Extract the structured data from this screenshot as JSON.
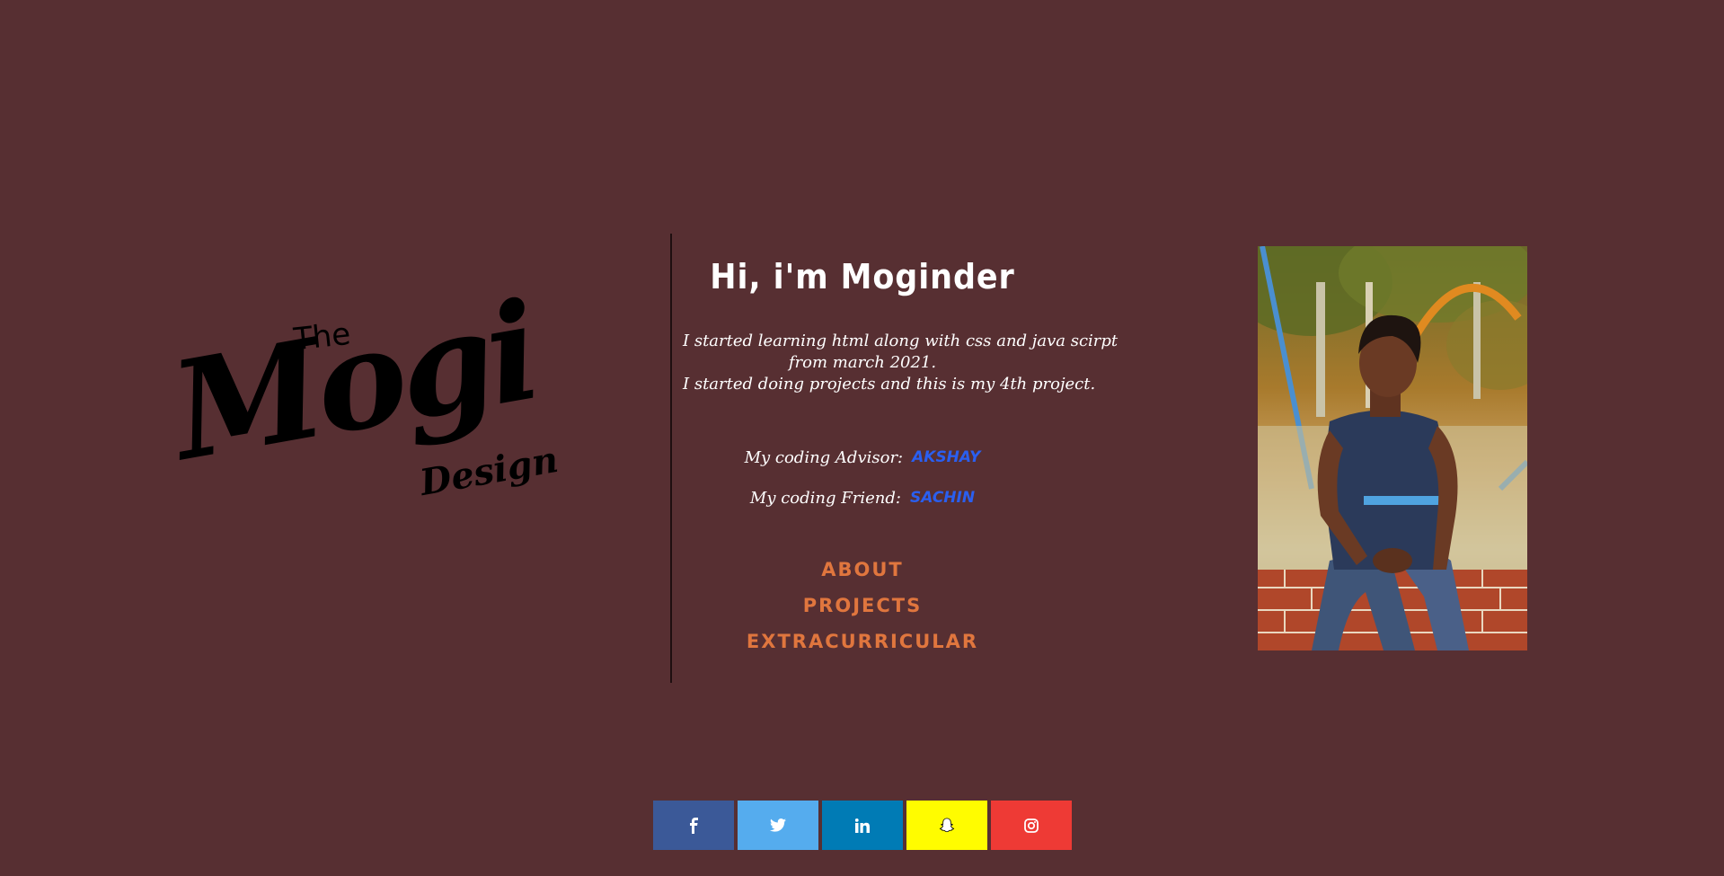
{
  "logo": {
    "the": "The",
    "mogi": "Mogi",
    "design": "Design"
  },
  "greeting": "Hi, i'm Moginder",
  "intro": {
    "line1": "I started learning html along with css and java scirpt",
    "line2": "from march 2021.",
    "line3": "I started doing projects and this is my 4th project."
  },
  "credits": {
    "advisor_label": "My coding Advisor:",
    "advisor_name": "AKSHAY",
    "friend_label": "My coding Friend:",
    "friend_name": "SACHIN"
  },
  "nav": {
    "about": "ABOUT",
    "projects": "PROJECTS",
    "extracurricular": "EXTRACURRICULAR"
  },
  "social": [
    {
      "name": "facebook",
      "icon": "facebook-icon",
      "color": "#3b5998"
    },
    {
      "name": "twitter",
      "icon": "twitter-icon",
      "color": "#55acee"
    },
    {
      "name": "linkedin",
      "icon": "linkedin-icon",
      "color": "#007bb5"
    },
    {
      "name": "snapchat",
      "icon": "snapchat-icon",
      "color": "#fffc00"
    },
    {
      "name": "instagram",
      "icon": "instagram-icon",
      "color": "#ee3a35"
    }
  ],
  "colors": {
    "background": "#572f32",
    "nav_link": "#e0763e",
    "credit_name": "#2a5ff0"
  }
}
